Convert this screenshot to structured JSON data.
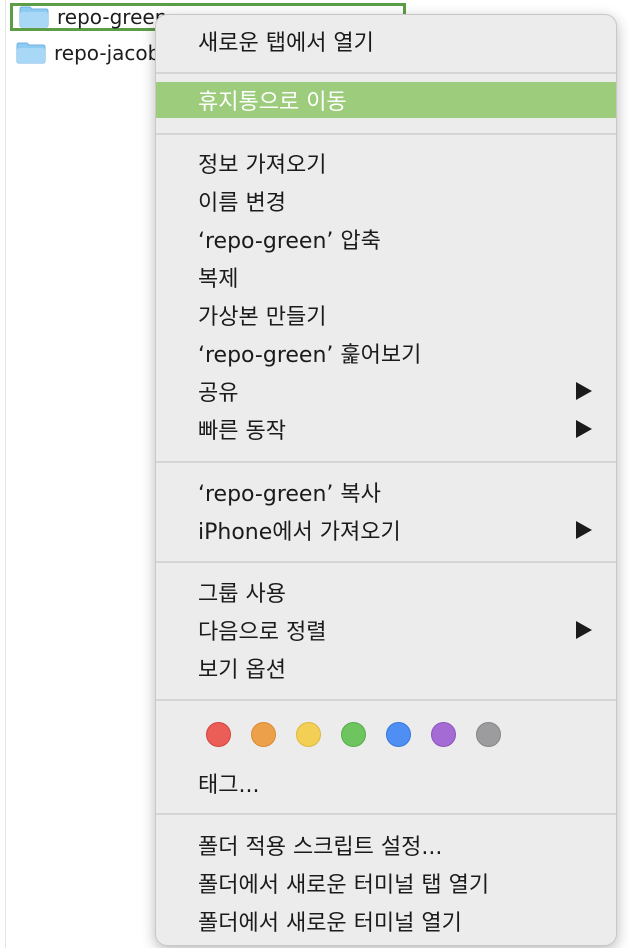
{
  "files": [
    {
      "name": "repo-green",
      "selected": true
    },
    {
      "name": "repo-jacobs",
      "selected": false
    }
  ],
  "menu": {
    "open_new_tab": "새로운 탭에서 열기",
    "move_to_trash": "휴지통으로 이동",
    "get_info": "정보 가져오기",
    "rename": "이름 변경",
    "compress": "‘repo-green’ 압축",
    "duplicate": "복제",
    "make_alias": "가상본 만들기",
    "quick_look": "‘repo-green’ 훑어보기",
    "share": "공유",
    "quick_actions": "빠른 동작",
    "copy": "‘repo-green’ 복사",
    "import_iphone": "iPhone에서 가져오기",
    "use_groups": "그룹 사용",
    "sort_by": "다음으로 정렬",
    "view_options": "보기 옵션",
    "tags_label": "태그...",
    "folder_actions": "폴더 적용 스크립트 설정...",
    "new_terminal_tab": "폴더에서 새로운 터미널 탭 열기",
    "new_terminal": "폴더에서 새로운 터미널 열기"
  },
  "tag_colors": [
    {
      "name": "red",
      "fill": "#eb5d57",
      "stroke": "#d3443f"
    },
    {
      "name": "orange",
      "fill": "#eda04a",
      "stroke": "#d98a33"
    },
    {
      "name": "yellow",
      "fill": "#f3cf56",
      "stroke": "#dbb83f"
    },
    {
      "name": "green",
      "fill": "#6ec55f",
      "stroke": "#57ad49"
    },
    {
      "name": "blue",
      "fill": "#4f8ef2",
      "stroke": "#3876da"
    },
    {
      "name": "purple",
      "fill": "#a56bd4",
      "stroke": "#8d55bc"
    },
    {
      "name": "gray",
      "fill": "#9c9c9e",
      "stroke": "#858587"
    }
  ],
  "highlight_color": "#9dcd7c",
  "selection_border_color": "#5b9e47"
}
